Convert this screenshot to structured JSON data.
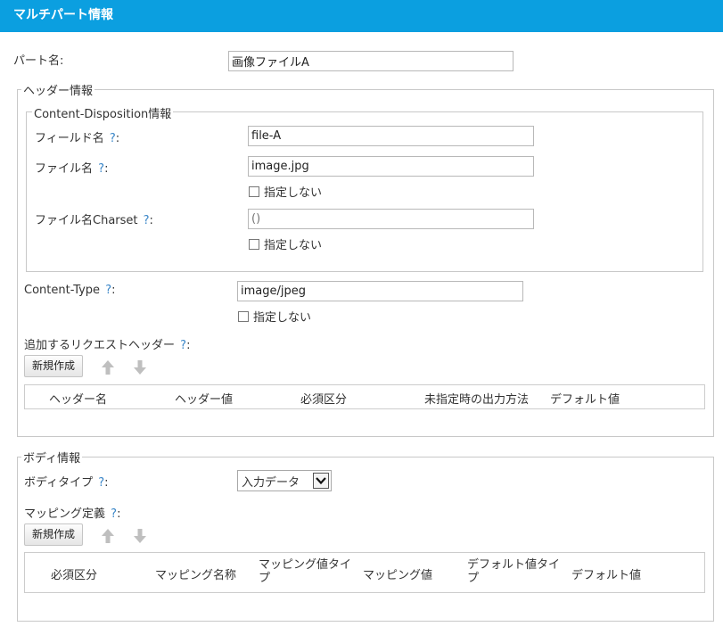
{
  "window": {
    "title": "マルチパート情報"
  },
  "part": {
    "label": "パート名:",
    "value": "画像ファイルA"
  },
  "header_info": {
    "legend": "ヘッダー情報",
    "content_disposition": {
      "legend": "Content-Disposition情報",
      "field_name": {
        "label": "フィールド名",
        "help": "?",
        "colon": ":",
        "value": "file-A"
      },
      "file_name": {
        "label": "ファイル名",
        "help": "?",
        "colon": ":",
        "value": "image.jpg",
        "unspecified_label": "指定しない",
        "unspecified_checked": false
      },
      "file_name_charset": {
        "label": "ファイル名Charset",
        "help": "?",
        "colon": ":",
        "placeholder": "()",
        "unspecified_label": "指定しない",
        "unspecified_checked": false
      }
    },
    "content_type": {
      "label": "Content-Type",
      "help": "?",
      "colon": ":",
      "value": "image/jpeg",
      "unspecified_label": "指定しない",
      "unspecified_checked": false
    },
    "request_headers": {
      "label": "追加するリクエストヘッダー",
      "help": "?",
      "colon": ":",
      "new_button": "新規作成",
      "columns": [
        "ヘッダー名",
        "ヘッダー値",
        "必須区分",
        "未指定時の出力方法",
        "デフォルト値"
      ]
    }
  },
  "body_info": {
    "legend": "ボディ情報",
    "body_type": {
      "label": "ボディタイプ",
      "help": "?",
      "colon": ":",
      "selected": "入力データ"
    },
    "mapping": {
      "label": "マッピング定義",
      "help": "?",
      "colon": ":",
      "new_button": "新規作成",
      "columns": [
        "必須区分",
        "マッピング名称",
        "マッピング値タイプ",
        "マッピング値",
        "デフォルト値タイプ",
        "デフォルト値"
      ]
    }
  },
  "colors": {
    "accent": "#0b9fe0",
    "help": "#3a86c8",
    "border": "#c8c8c8"
  },
  "icons": [
    "arrow-up-icon",
    "arrow-down-icon",
    "chevron-down-icon",
    "checkbox-icon"
  ]
}
